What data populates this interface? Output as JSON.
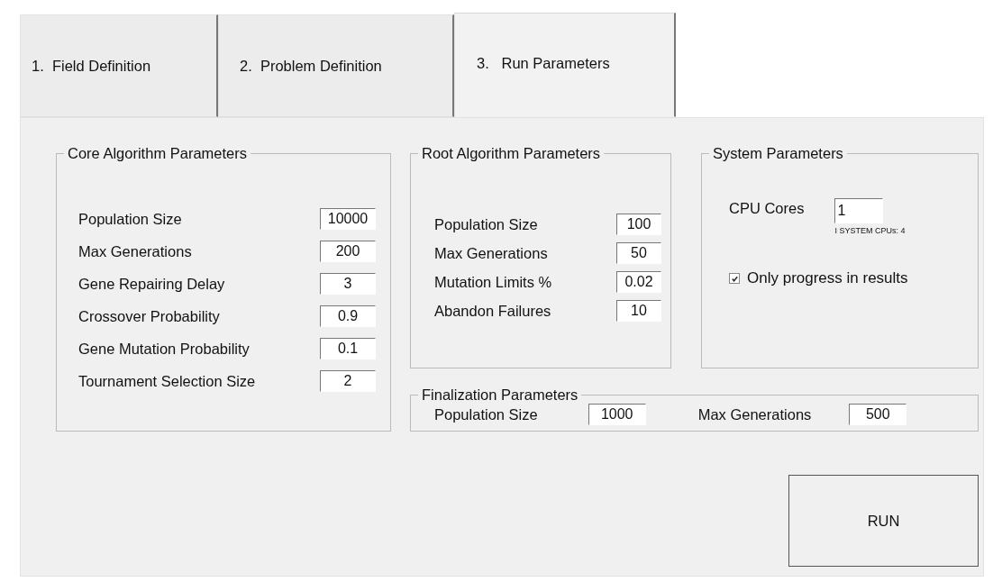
{
  "tabs": [
    {
      "label": "1.  Field Definition",
      "selected": false
    },
    {
      "label": "2.  Problem Definition",
      "selected": false
    },
    {
      "label": "3.   Run Parameters",
      "selected": true
    }
  ],
  "core": {
    "title": "Core Algorithm Parameters",
    "fields": [
      {
        "label": "Population Size",
        "value": "10000"
      },
      {
        "label": "Max Generations",
        "value": "200"
      },
      {
        "label": "Gene Repairing Delay",
        "value": "3"
      },
      {
        "label": "Crossover Probability",
        "value": "0.9"
      },
      {
        "label": "Gene Mutation Probability",
        "value": "0.1"
      },
      {
        "label": "Tournament Selection Size",
        "value": "2"
      }
    ]
  },
  "root": {
    "title": "Root Algorithm Parameters",
    "fields": [
      {
        "label": "Population Size",
        "value": "100"
      },
      {
        "label": "Max Generations",
        "value": "50"
      },
      {
        "label": "Mutation Limits %",
        "value": "0.02"
      },
      {
        "label": "Abandon Failures",
        "value": "10"
      }
    ]
  },
  "system": {
    "title": "System Parameters",
    "cpu_label": "CPU Cores",
    "cpu_value": "1",
    "cpu_note": "I SYSTEM CPUs: 4",
    "checkbox": {
      "label": "Only progress in results",
      "checked": true
    }
  },
  "finalization": {
    "title": "Finalization Parameters",
    "fields": [
      {
        "label": "Population Size",
        "value": "1000"
      },
      {
        "label": "Max Generations",
        "value": "500"
      }
    ]
  },
  "run_button": "RUN"
}
